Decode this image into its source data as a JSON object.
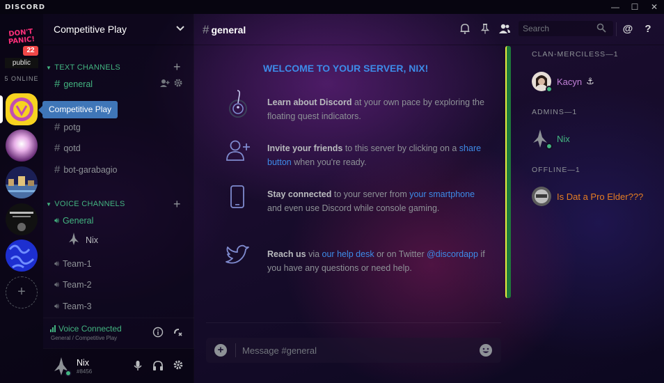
{
  "app": {
    "title": "DISCORD",
    "window_buttons": [
      "minimize",
      "maximize",
      "close"
    ]
  },
  "servers": {
    "top_server": {
      "text": "DON'T PANIC!",
      "badge": "22",
      "label": "public"
    },
    "online_label": "5 ONLINE",
    "tooltip": "Competitive Play",
    "add_label": "+"
  },
  "guild": {
    "name": "Competitive Play",
    "text_category": "TEXT CHANNELS",
    "text_channels": [
      "general",
      "potg",
      "qotd",
      "bot-garabagio"
    ],
    "voice_category": "VOICE CHANNELS",
    "voice_channels": [
      "General",
      "Team-1",
      "Team-2",
      "Team-3"
    ],
    "voice_user": "Nix"
  },
  "voice_panel": {
    "status": "Voice Connected",
    "location": "General / Competitive Play"
  },
  "user_panel": {
    "name": "Nix",
    "tag": "#8456"
  },
  "chat": {
    "channel": "general",
    "search_placeholder": "Search",
    "input_placeholder": "Message #general"
  },
  "welcome": {
    "title": "WELCOME TO YOUR SERVER, NIX!",
    "items": [
      {
        "bold": "Learn about Discord",
        "text": " at your own pace by exploring the floating quest indicators."
      },
      {
        "bold": "Invite your friends",
        "text": " to this server by clicking on a ",
        "link": "share button",
        "tail": " when you're ready."
      },
      {
        "bold": "Stay connected",
        "text": " to your server from ",
        "link": "your smartphone",
        "tail": " and even use Discord while console gaming."
      },
      {
        "bold": "Reach us",
        "text": " via ",
        "link": "our help desk",
        "mid": " or on Twitter ",
        "link2": "@discordapp",
        "tail": " if you have any questions or need help."
      }
    ]
  },
  "members": {
    "groups": [
      {
        "header": "CLAN-MERCILESS—1",
        "members": [
          {
            "name": "Kacyn",
            "color": "#c280d8",
            "suffix": "⚓"
          }
        ]
      },
      {
        "header": "ADMINS—1",
        "members": [
          {
            "name": "Nix",
            "color": "#43b581"
          }
        ]
      },
      {
        "header": "OFFLINE—1",
        "members": [
          {
            "name": "Is Dat a Pro Elder???",
            "color": "#e67e22"
          }
        ]
      }
    ]
  },
  "colors": {
    "accent": "#3d8be8",
    "online": "#43b581",
    "badge": "#f04747",
    "scroll_track": "#1e7a3a",
    "scroll_edge": "#e9ef3e"
  }
}
